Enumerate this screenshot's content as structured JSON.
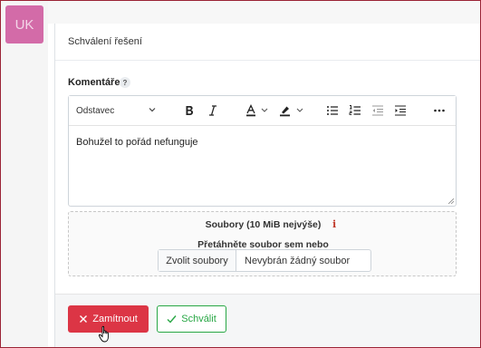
{
  "user": {
    "initials": "UK"
  },
  "card": {
    "title": "Schválení řešení"
  },
  "comment": {
    "label": "Komentáře",
    "help": "?",
    "format_selected": "Odstavec",
    "text": "Bohužel to pořád nefunguje"
  },
  "attachments": {
    "title": "Soubory (10 MiB nejvýše)",
    "info_icon": "i",
    "drop_text": "Přetáhněte soubor sem nebo",
    "choose_label": "Zvolit soubory",
    "no_file_label": "Nevybrán žádný soubor"
  },
  "actions": {
    "reject_label": "Zamítnout",
    "approve_label": "Schválit"
  },
  "colors": {
    "avatar": "#d36ba8",
    "danger": "#dc3545",
    "success": "#28a745",
    "frame": "#9b2335"
  },
  "icons": [
    "bold-icon",
    "italic-icon",
    "font-color-icon",
    "highlight-icon",
    "bulleted-list-icon",
    "numbered-list-icon",
    "outdent-icon",
    "indent-icon",
    "more-icon",
    "info-icon",
    "x-icon",
    "check-icon",
    "hand-cursor-icon"
  ]
}
